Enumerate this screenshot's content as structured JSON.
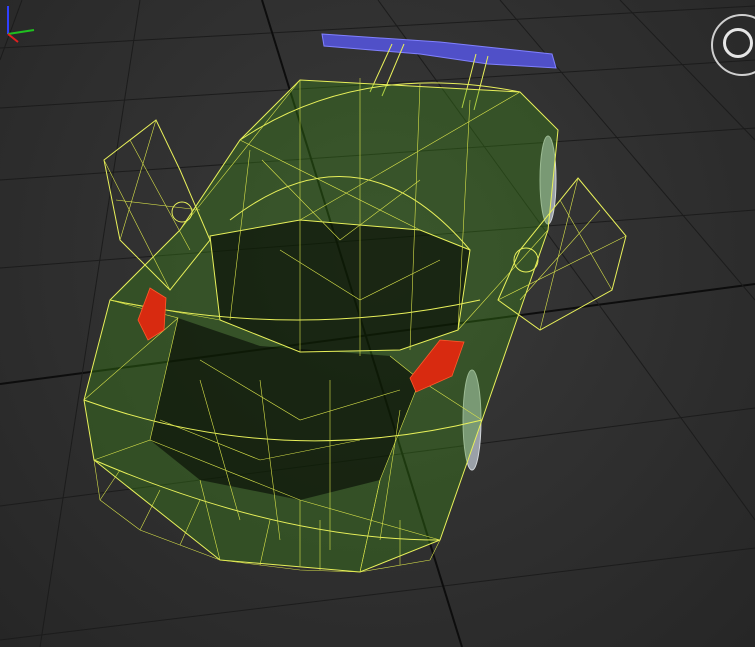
{
  "viewport": {
    "background_color": "#2c2c2c",
    "grid_color": "#1c1c1c",
    "wireframe_color": "#e8f05a",
    "body_tint_color": "#3c8c14",
    "spoiler_color": "#5050c8",
    "taillight_color": "#d82a10"
  },
  "viewcube": {
    "icon": "viewcube-icon"
  },
  "axis_gizmo": {
    "icon": "axis-tripod-icon",
    "x_color": "#e02020",
    "y_color": "#20c020",
    "z_color": "#3040ff"
  },
  "model": {
    "icon": "wireframe-car-model"
  }
}
